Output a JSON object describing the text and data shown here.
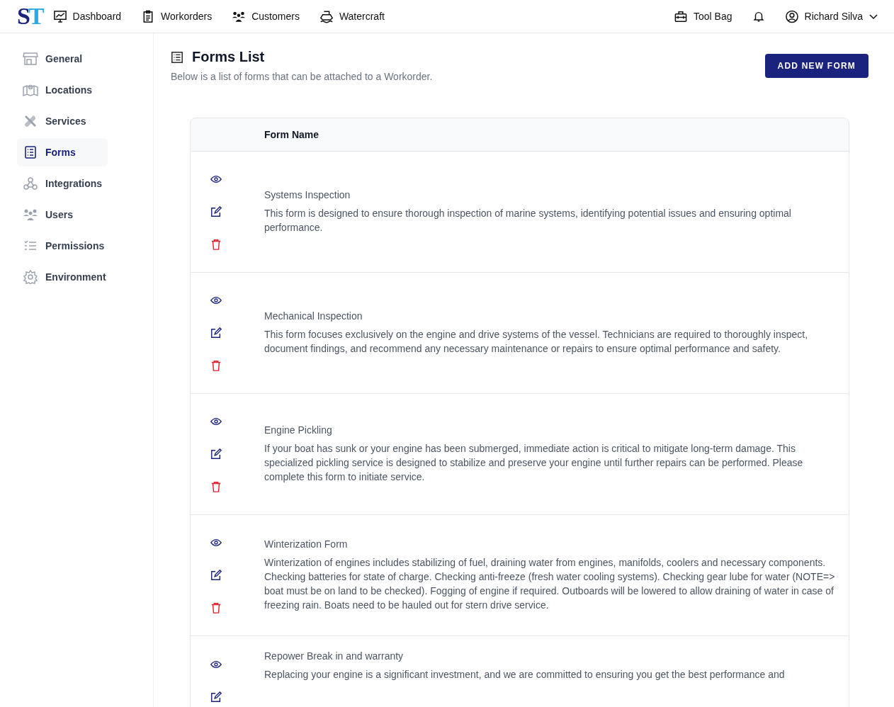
{
  "topbar": {
    "logo": [
      "S",
      "T"
    ],
    "nav": [
      {
        "label": "Dashboard"
      },
      {
        "label": "Workorders"
      },
      {
        "label": "Customers"
      },
      {
        "label": "Watercraft"
      }
    ],
    "toolbag": "Tool Bag",
    "user": "Richard Silva"
  },
  "sidebar": {
    "items": [
      {
        "label": "General",
        "selected": false
      },
      {
        "label": "Locations",
        "selected": false
      },
      {
        "label": "Services",
        "selected": false
      },
      {
        "label": "Forms",
        "selected": true
      },
      {
        "label": "Integrations",
        "selected": false
      },
      {
        "label": "Users",
        "selected": false
      },
      {
        "label": "Permissions",
        "selected": false
      },
      {
        "label": "Environment",
        "selected": false
      }
    ]
  },
  "page": {
    "title": "Forms List",
    "subtitle": "Below is a list of forms that can be attached to a Workorder.",
    "add_button": "ADD NEW FORM"
  },
  "table": {
    "columns": [
      "Form Name"
    ],
    "rows": [
      {
        "name": "Systems Inspection",
        "description": "This form is designed to ensure thorough inspection of marine systems, identifying potential issues and ensuring optimal performance."
      },
      {
        "name": "Mechanical Inspection",
        "description": "This form focuses exclusively on the engine and drive systems of the vessel. Technicians are required to thoroughly inspect, document findings, and recommend any necessary maintenance or repairs to ensure optimal performance and safety."
      },
      {
        "name": "Engine Pickling",
        "description": "If your boat has sunk or your engine has been submerged, immediate action is critical to mitigate long-term damage. This specialized pickling service is designed to stabilize and preserve your engine until further repairs can be performed. Please complete this form to initiate service."
      },
      {
        "name": "Winterization Form",
        "description": "Winterization of engines includes stabilizing of fuel, draining water from engines, manifolds, coolers and necessary components. Checking batteries for state of charge. Checking anti-freeze (fresh water cooling systems). Checking gear lube for water (NOTE=> boat must be on land to be checked). Fogging of engine if required. Outboards will be lowered to allow draining of water in case of freezing rain. Boats need to be hauled out for stern drive service."
      },
      {
        "name": "Repower Break in and warranty",
        "description": "Replacing your engine is a significant investment, and we are committed to ensuring you get the best performance and"
      }
    ]
  }
}
